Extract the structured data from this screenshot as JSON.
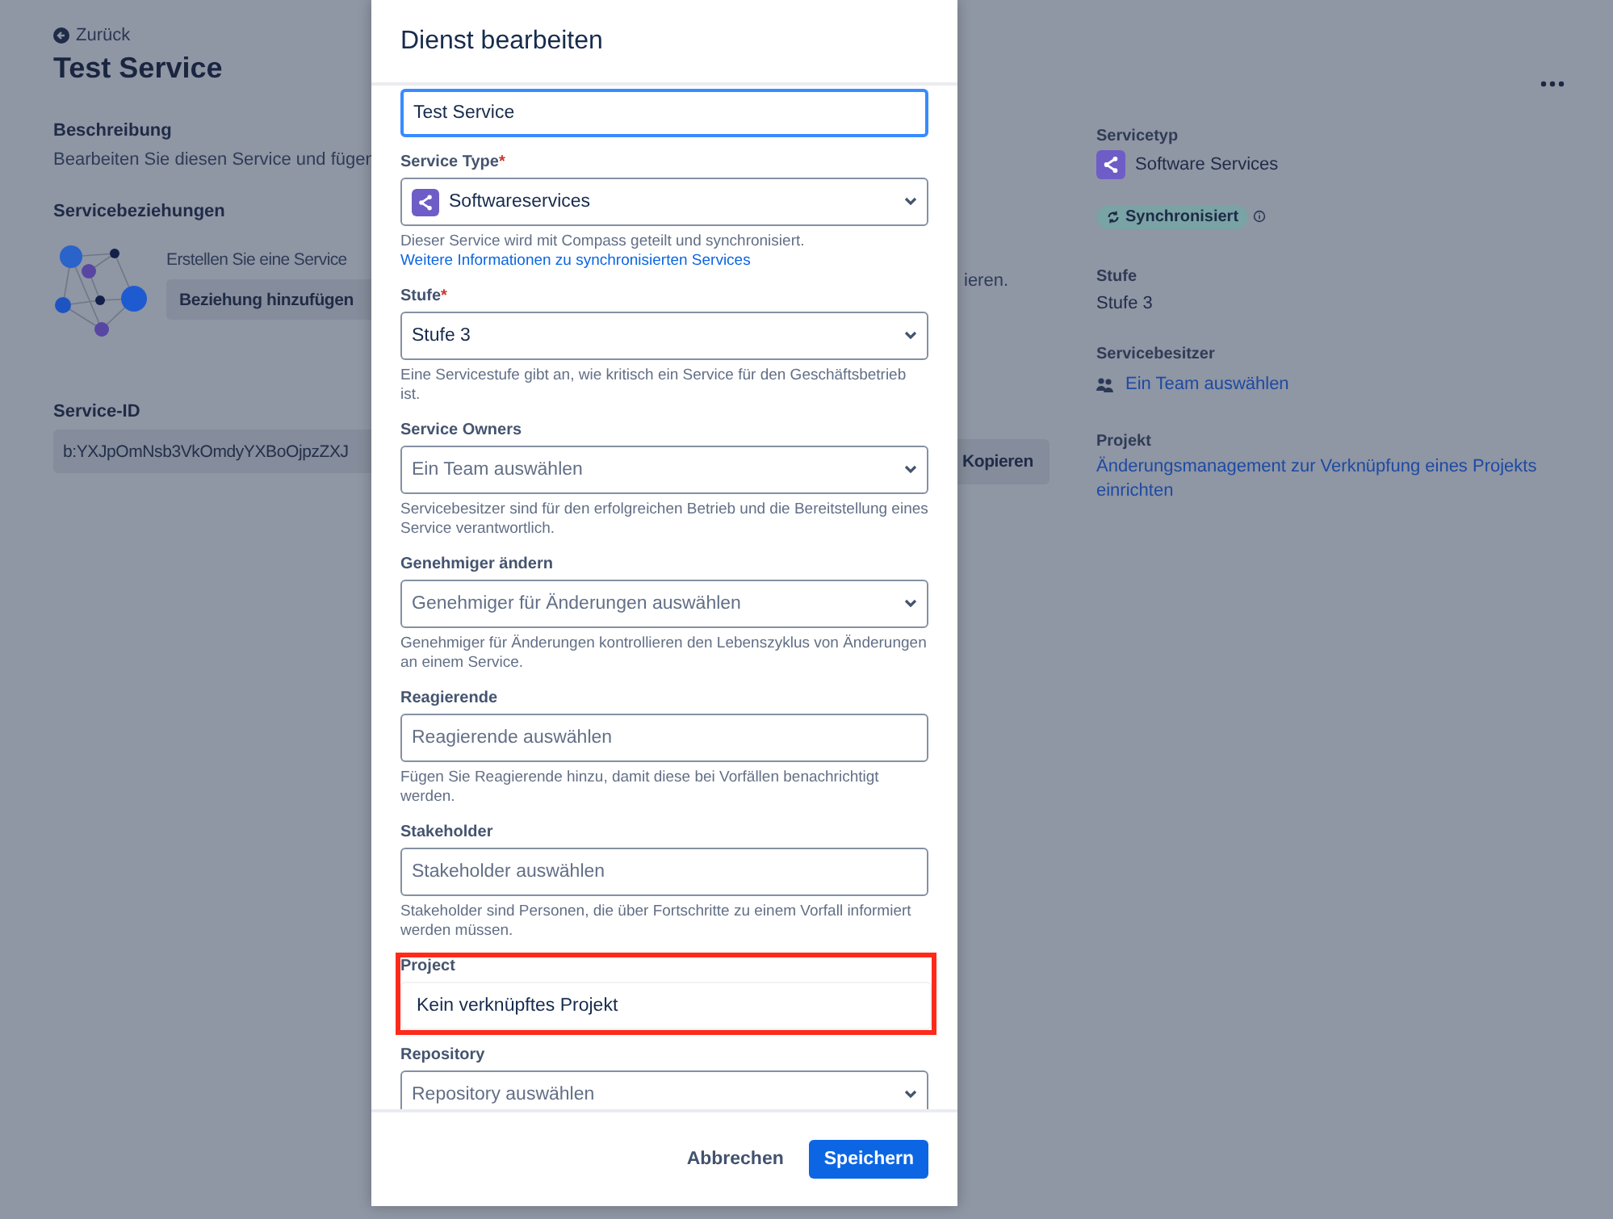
{
  "page": {
    "back": "Zurück",
    "title": "Test Service",
    "description": {
      "heading": "Beschreibung",
      "text": "Bearbeiten Sie diesen Service und fügen"
    },
    "relations": {
      "heading": "Servicebeziehungen",
      "text": "Erstellen Sie eine Service",
      "text_end": "ieren.",
      "button": "Beziehung hinzufügen"
    },
    "service_id": {
      "heading": "Service-ID",
      "value": "b:YXJpOmNsb3VkOmdyYXBoOjpzZXJ",
      "copy_button": "Kopieren"
    }
  },
  "details": {
    "service_type": {
      "label": "Servicetyp",
      "value": "Software Services"
    },
    "sync_badge": "Synchronisiert",
    "tier": {
      "label": "Stufe",
      "value": "Stufe 3"
    },
    "owner": {
      "label": "Servicebesitzer",
      "link": "Ein Team auswählen"
    },
    "project": {
      "label": "Projekt",
      "link": "Änderungsmanagement zur Verknüpfung eines Projekts einrichten"
    }
  },
  "modal": {
    "title": "Dienst bearbeiten",
    "fields": [
      {
        "kind": "text",
        "value": "Test Service",
        "focused": true
      },
      {
        "kind": "select",
        "label": "Service Type",
        "required_mark": "*",
        "value": "Softwareservices",
        "icon": true,
        "help": "Dieser Service wird mit Compass geteilt und synchronisiert. ",
        "help_link": "Weitere Informationen zu synchronisierten Services"
      },
      {
        "kind": "select",
        "label": "Stufe",
        "required_mark": "*",
        "value": "Stufe 3",
        "help": "Eine Servicestufe gibt an, wie kritisch ein Service für den Geschäftsbetrieb ist."
      },
      {
        "kind": "select",
        "label": "Service Owners",
        "placeholder": "Ein Team auswählen",
        "help": "Servicebesitzer sind für den erfolgreichen Betrieb und die Bereitstellung eines Service verantwortlich."
      },
      {
        "kind": "select",
        "label": "Genehmiger ändern",
        "placeholder": "Genehmiger für Änderungen auswählen",
        "help": "Genehmiger für Änderungen kontrollieren den Lebenszyklus von Änderungen an einem Service."
      },
      {
        "kind": "input",
        "label": "Reagierende",
        "placeholder": "Reagierende auswählen",
        "help": "Fügen Sie Reagierende hinzu, damit diese bei Vorfällen benachrichtigt werden."
      },
      {
        "kind": "input",
        "label": "Stakeholder",
        "placeholder": "Stakeholder auswählen",
        "help": "Stakeholder sind Personen, die über Fortschritte zu einem Vorfall informiert werden müssen."
      },
      {
        "kind": "readonly",
        "label": "Project",
        "value": "Kein verknüpftes Projekt",
        "highlighted": true
      },
      {
        "kind": "select",
        "label": "Repository",
        "placeholder": "Repository auswählen"
      }
    ],
    "cancel": "Abbrechen",
    "save": "Speichern"
  }
}
